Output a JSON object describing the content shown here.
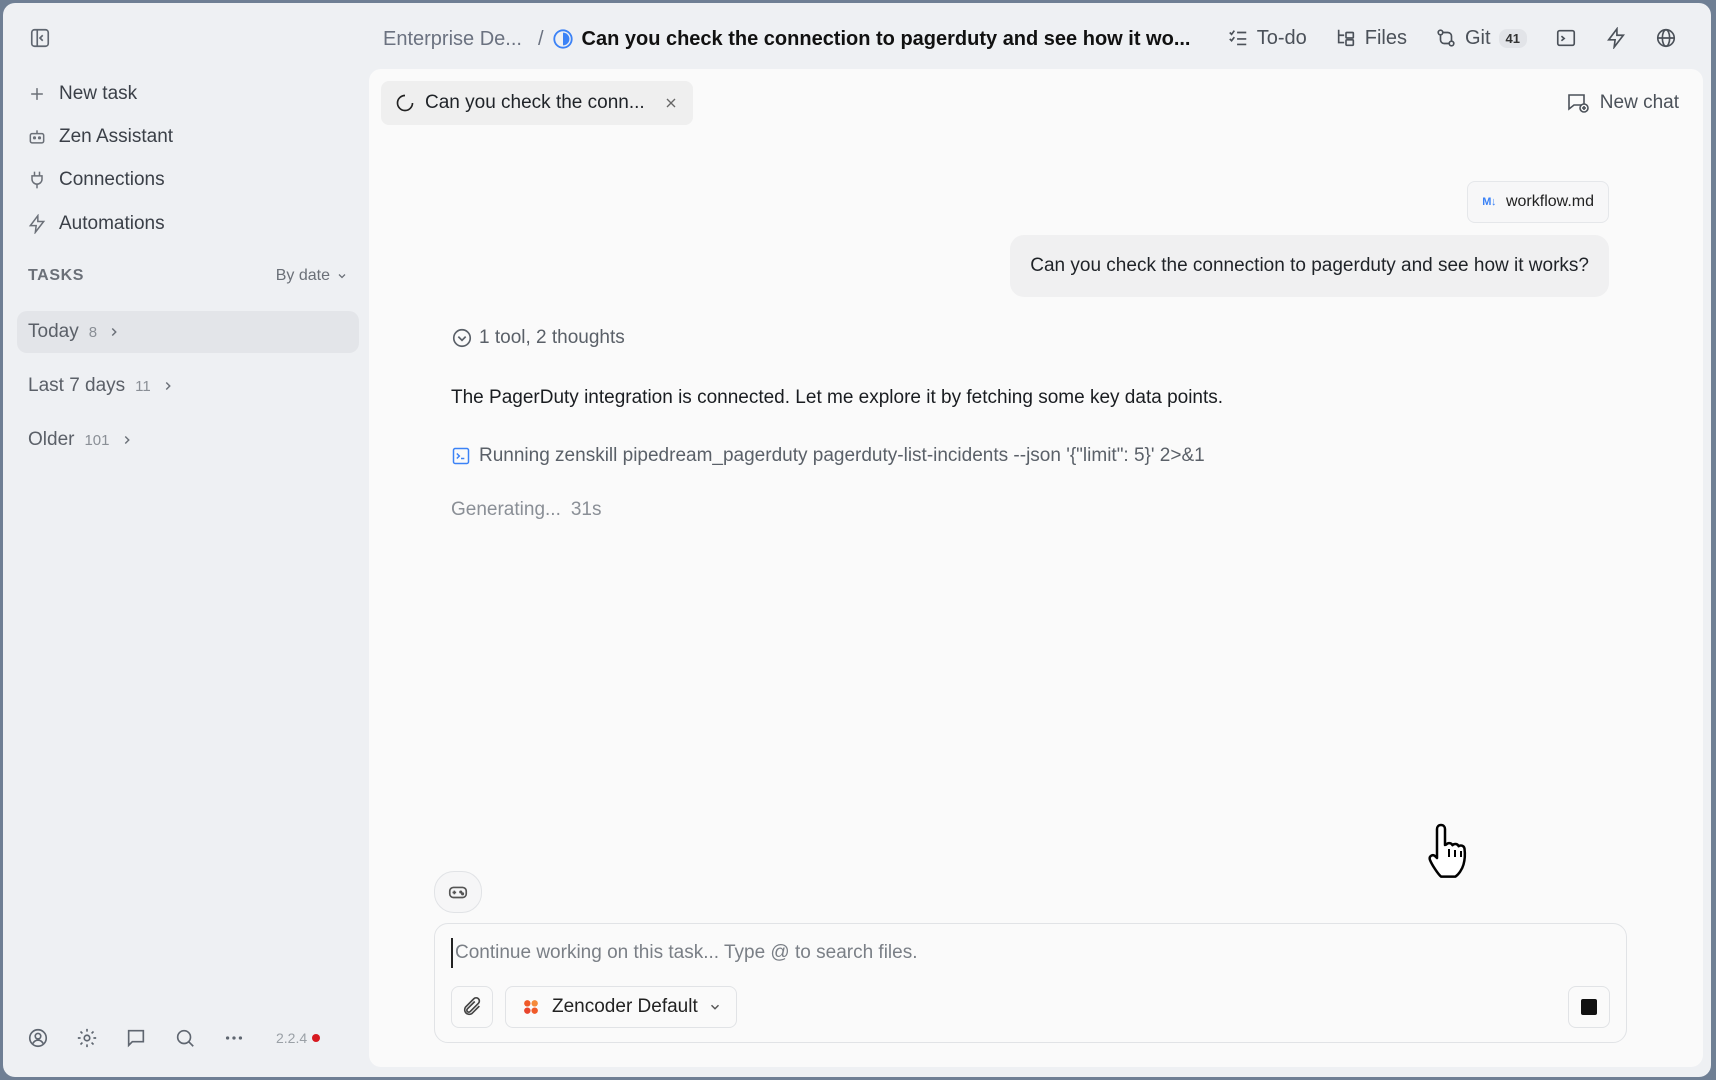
{
  "breadcrumb": {
    "project": "Enterprise De...",
    "separator": "/",
    "task_title": "Can you check the connection to pagerduty and see how it wo..."
  },
  "top_actions": {
    "todo": "To-do",
    "files": "Files",
    "git": "Git",
    "git_count": "41"
  },
  "sidebar": {
    "nav": [
      {
        "label": "New task",
        "icon": "plus-icon"
      },
      {
        "label": "Zen Assistant",
        "icon": "robot-icon"
      },
      {
        "label": "Connections",
        "icon": "plug-icon"
      },
      {
        "label": "Automations",
        "icon": "lightning-icon"
      }
    ],
    "tasks_label": "TASKS",
    "sort_label": "By date",
    "groups": [
      {
        "label": "Today",
        "count": "8"
      },
      {
        "label": "Last 7 days",
        "count": "11"
      },
      {
        "label": "Older",
        "count": "101"
      }
    ],
    "version": "2.2.4"
  },
  "chat": {
    "tab_title": "Can you check the conn...",
    "new_chat_label": "New chat",
    "attachment_name": "workflow.md",
    "attachment_badge": "M↓",
    "user_message": "Can you check the connection to pagerduty and see how it works?",
    "thoughts_summary": "1 tool, 2 thoughts",
    "assistant_message": "The PagerDuty integration is connected. Let me explore it by fetching some key data points.",
    "tool_running": "Running zenskill pipedream_pagerduty pagerduty-list-incidents --json '{\"limit\": 5}' 2>&1",
    "generating_label": "Generating...",
    "generating_time": "31s"
  },
  "composer": {
    "placeholder": "Continue working on this task... Type @ to search files.",
    "model": "Zencoder Default"
  },
  "colors": {
    "accent_blue": "#3b82f6",
    "status_red": "#d71920",
    "zencoder_orange": "#f05a28"
  }
}
